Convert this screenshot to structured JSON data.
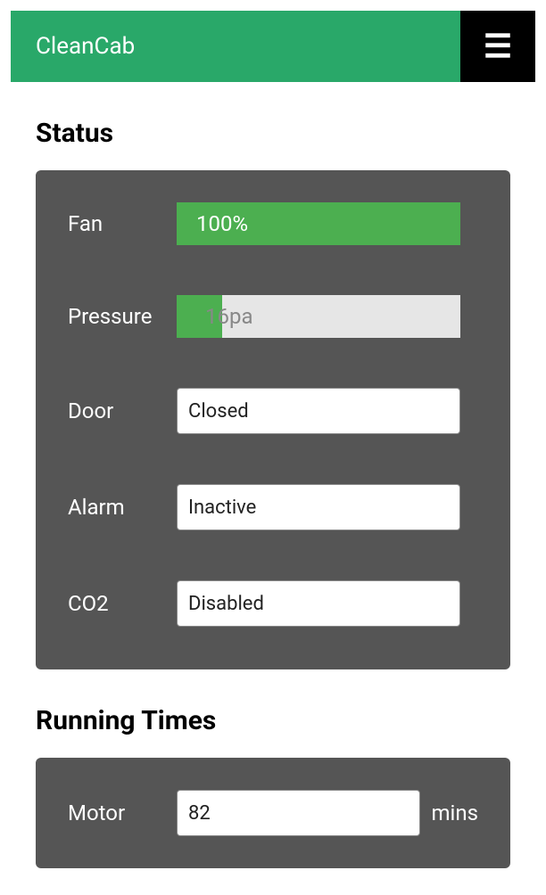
{
  "header": {
    "app_title": "CleanCab",
    "menu_icon": "☰"
  },
  "sections": {
    "status": {
      "title": "Status",
      "fan": {
        "label": "Fan",
        "value_pct": 100,
        "display": "100%"
      },
      "pressure": {
        "label": "Pressure",
        "value_pct": 16,
        "display": "16pa"
      },
      "door": {
        "label": "Door",
        "value": "Closed"
      },
      "alarm": {
        "label": "Alarm",
        "value": "Inactive"
      },
      "co2": {
        "label": "CO2",
        "value": "Disabled"
      }
    },
    "running_times": {
      "title": "Running Times",
      "motor": {
        "label": "Motor",
        "value": "82",
        "unit": "mins"
      }
    }
  },
  "colors": {
    "brand": "#29a869",
    "progress": "#4caf50",
    "panel": "#555555"
  }
}
